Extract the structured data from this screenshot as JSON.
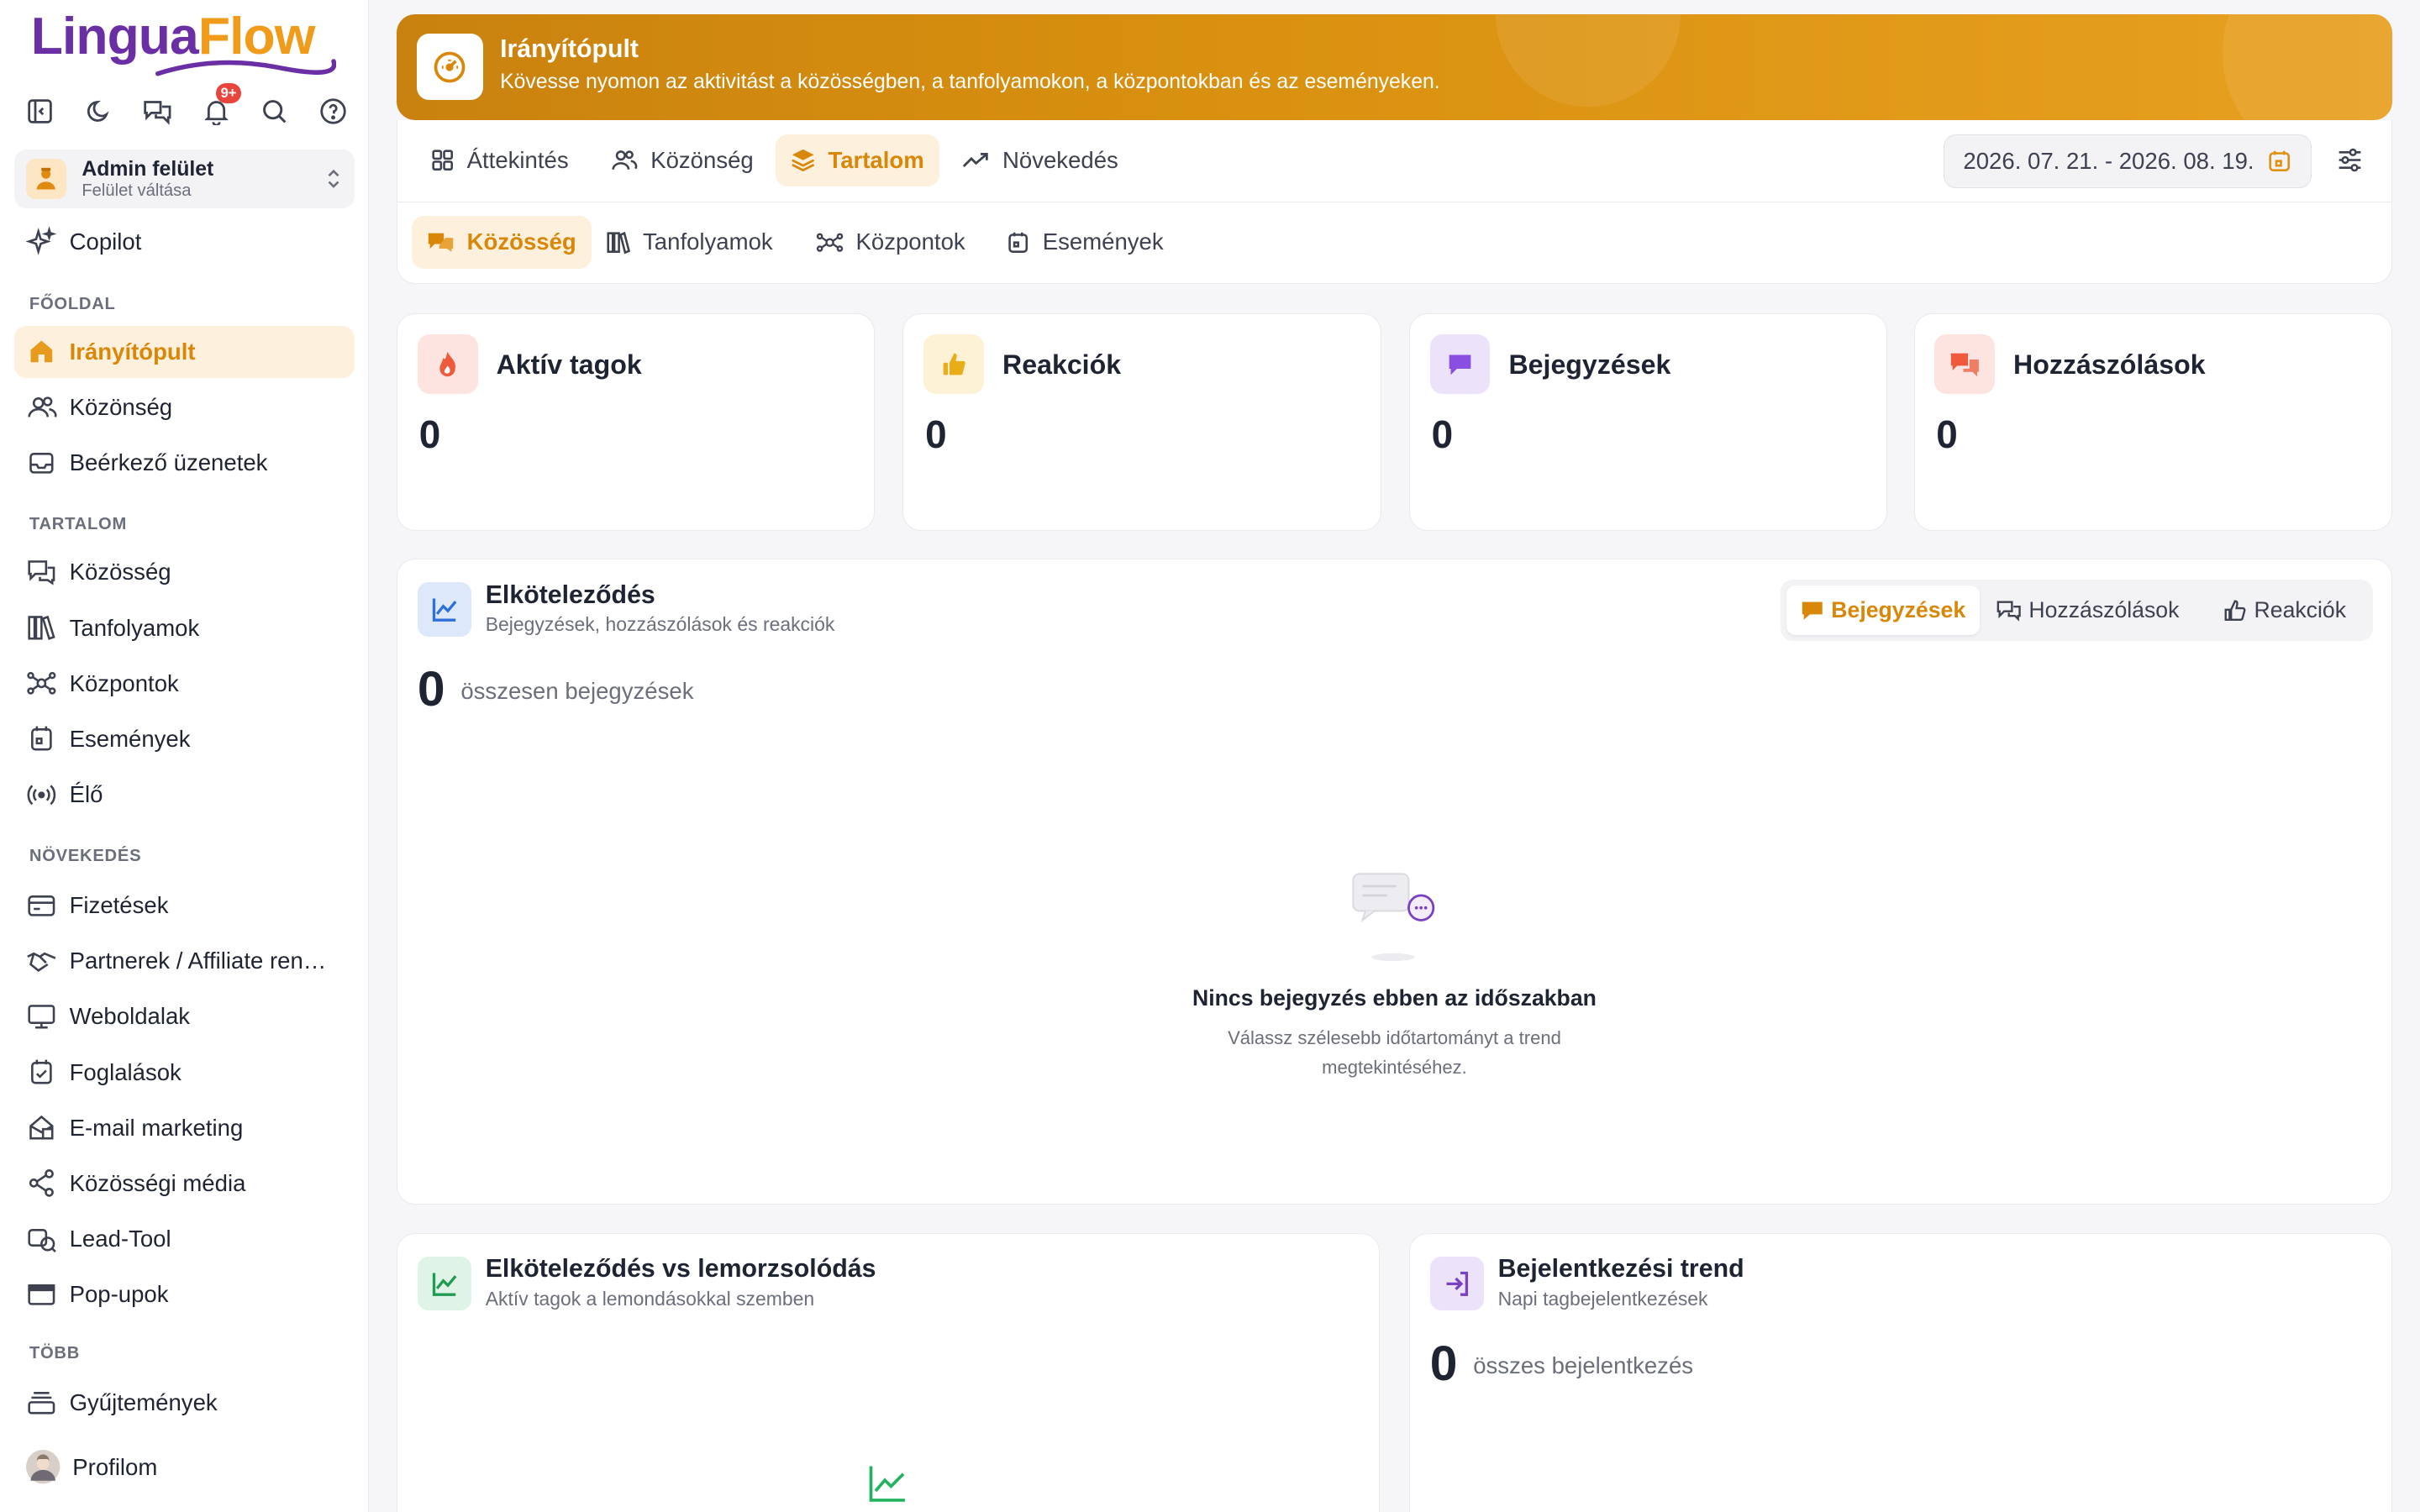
{
  "app": {
    "logo_part1": "Lingua",
    "logo_part2": "Flow",
    "notif_badge": "9+"
  },
  "switcher": {
    "title": "Admin felület",
    "subtitle": "Felület váltása"
  },
  "sidebar": {
    "copilot": "Copilot",
    "sec_main": "FŐOLDAL",
    "dashboard": "Irányítópult",
    "audience": "Közönség",
    "inbox": "Beérkező üzenetek",
    "sec_content": "TARTALOM",
    "community": "Közösség",
    "courses": "Tanfolyamok",
    "hubs": "Központok",
    "events": "Események",
    "live": "Élő",
    "sec_growth": "NÖVEKEDÉS",
    "payments": "Fizetések",
    "affiliates": "Partnerek / Affiliate ren…",
    "websites": "Weboldalak",
    "bookings": "Foglalások",
    "email": "E-mail marketing",
    "social": "Közösségi média",
    "lead": "Lead-Tool",
    "popups": "Pop-upok",
    "sec_more": "TÖBB",
    "collections": "Gyűjtemények",
    "profile": "Profilom"
  },
  "banner": {
    "title": "Irányítópult",
    "subtitle": "Kövesse nyomon az aktivitást a közösségben, a tanfolyamokon, a központokban és az eseményeken."
  },
  "tabs": {
    "overview": "Áttekintés",
    "audience": "Közönség",
    "content": "Tartalom",
    "growth": "Növekedés",
    "date_range": "2026. 07. 21. - 2026. 08. 19."
  },
  "subtabs": {
    "community": "Közösség",
    "courses": "Tanfolyamok",
    "hubs": "Központok",
    "events": "Események"
  },
  "stats": [
    {
      "title": "Aktív tagok",
      "value": "0"
    },
    {
      "title": "Reakciók",
      "value": "0"
    },
    {
      "title": "Bejegyzések",
      "value": "0"
    },
    {
      "title": "Hozzászólások",
      "value": "0"
    }
  ],
  "engagement": {
    "title": "Elköteleződés",
    "subtitle": "Bejegyzések, hozzászólások és reakciók",
    "seg_posts": "Bejegyzések",
    "seg_comments": "Hozzászólások",
    "seg_reactions": "Reakciók",
    "total": "0",
    "total_label": "összesen bejegyzések",
    "empty_title": "Nincs bejegyzés ebben az időszakban",
    "empty_sub": "Válassz szélesebb időtartományt a trend megtekintéséhez."
  },
  "churn": {
    "title": "Elköteleződés vs lemorzsolódás",
    "subtitle": "Aktív tagok a lemondásokkal szemben"
  },
  "logins": {
    "title": "Bejelentkezési trend",
    "subtitle": "Napi tagbejelentkezések",
    "total": "0",
    "total_label": "összes bejelentkezés"
  },
  "colors": {
    "accent": "#d98708",
    "brand_purple": "#6b2fa5"
  }
}
